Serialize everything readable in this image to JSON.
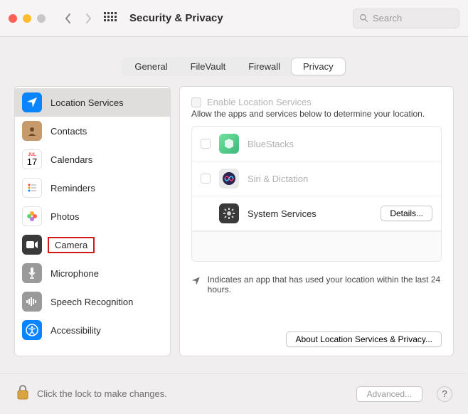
{
  "window": {
    "title": "Security & Privacy"
  },
  "search": {
    "placeholder": "Search"
  },
  "tabs": {
    "general": "General",
    "filevault": "FileVault",
    "firewall": "Firewall",
    "privacy": "Privacy"
  },
  "sidebar": {
    "items": [
      {
        "label": "Location Services",
        "icon": "location",
        "bg": "#0a84ff"
      },
      {
        "label": "Contacts",
        "icon": "contacts",
        "bg": "#c79a6b"
      },
      {
        "label": "Calendars",
        "icon": "calendar",
        "bg": "#ffffff"
      },
      {
        "label": "Reminders",
        "icon": "reminders",
        "bg": "#ffffff"
      },
      {
        "label": "Photos",
        "icon": "photos",
        "bg": "#ffffff"
      },
      {
        "label": "Camera",
        "icon": "camera",
        "bg": "#3a3a3a"
      },
      {
        "label": "Microphone",
        "icon": "microphone",
        "bg": "#9a9a9a"
      },
      {
        "label": "Speech Recognition",
        "icon": "speech",
        "bg": "#9a9a9a"
      },
      {
        "label": "Accessibility",
        "icon": "accessibility",
        "bg": "#0a84ff"
      }
    ]
  },
  "detail": {
    "enable_label": "Enable Location Services",
    "allow_text": "Allow the apps and services below to determine your location.",
    "apps": [
      {
        "name": "BlueStacks",
        "dim": true,
        "checkbox": true
      },
      {
        "name": "Siri & Dictation",
        "dim": true,
        "checkbox": true
      },
      {
        "name": "System Services",
        "dim": false,
        "checkbox": false,
        "button": "Details..."
      }
    ],
    "indicator_text": "Indicates an app that has used your location within the last 24 hours.",
    "about_button": "About Location Services & Privacy..."
  },
  "footer": {
    "lock_text": "Click the lock to make changes.",
    "advanced": "Advanced...",
    "help": "?"
  },
  "calendar_day": "17"
}
